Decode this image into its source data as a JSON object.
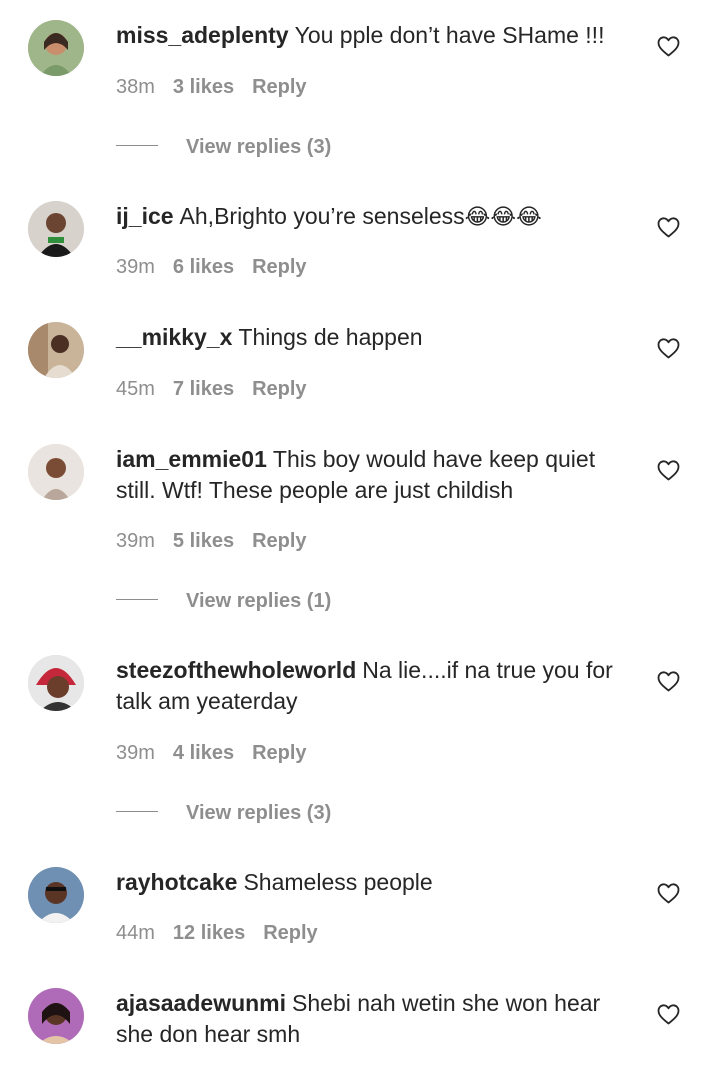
{
  "comments": [
    {
      "username": "miss_adeplenty",
      "text": "You pple don’t have SHame !!!",
      "time": "38m",
      "likes": "3 likes",
      "reply": "Reply",
      "view_replies": "View replies (3)"
    },
    {
      "username": "ij_ice",
      "text": "Ah,Brighto you’re senseless",
      "emoji": "😂😂😂",
      "time": "39m",
      "likes": "6 likes",
      "reply": "Reply"
    },
    {
      "username": "__mikky_x",
      "text": "Things de happen",
      "time": "45m",
      "likes": "7 likes",
      "reply": "Reply"
    },
    {
      "username": "iam_emmie01",
      "text": "This boy would have keep quiet still. Wtf! These people are just childish",
      "time": "39m",
      "likes": "5 likes",
      "reply": "Reply",
      "view_replies": "View replies (1)"
    },
    {
      "username": "steezofthewholeworld",
      "text": "Na lie....if na true you for talk am yeaterday",
      "time": "39m",
      "likes": "4 likes",
      "reply": "Reply",
      "view_replies": "View replies (3)"
    },
    {
      "username": "rayhotcake",
      "text": "Shameless people",
      "time": "44m",
      "likes": "12 likes",
      "reply": "Reply"
    },
    {
      "username": "ajasaadewunmi",
      "text": "Shebi nah wetin she won hear she don hear smh",
      "time": "",
      "likes": "",
      "reply": ""
    }
  ],
  "icons": {
    "like": "heart-outline-icon"
  },
  "colors": {
    "text": "#262626",
    "muted": "#8e8e8e"
  }
}
